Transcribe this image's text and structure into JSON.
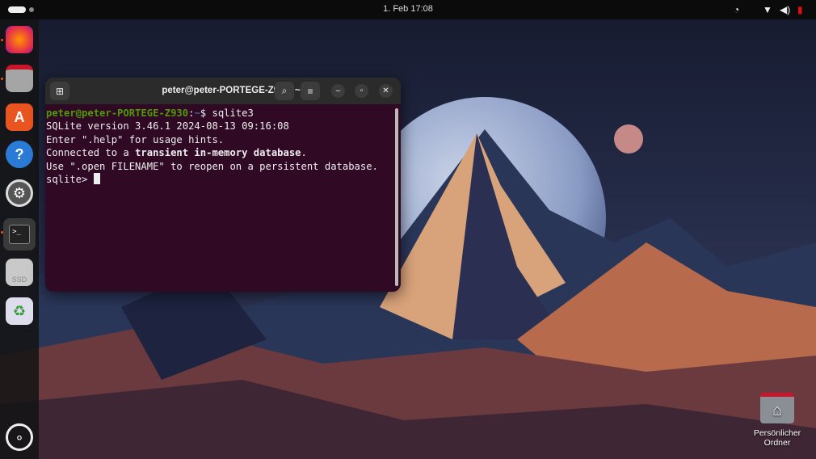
{
  "topbar": {
    "clock": "1. Feb  17:08",
    "tray_icons": [
      "power-profile-icon",
      "wifi-icon",
      "volume-icon",
      "battery-low-icon"
    ]
  },
  "dock": {
    "items": [
      {
        "name": "firefox"
      },
      {
        "name": "files"
      },
      {
        "name": "app-center"
      },
      {
        "name": "help",
        "glyph": "?"
      },
      {
        "name": "settings"
      },
      {
        "name": "terminal",
        "glyph": ">_"
      },
      {
        "name": "ssd",
        "glyph": "SSD"
      },
      {
        "name": "trash"
      },
      {
        "name": "show-apps"
      }
    ]
  },
  "terminal": {
    "title": "peter@peter-PORTEGE-Z930: ~",
    "prompt_user": "peter@peter-PORTEGE-Z930",
    "prompt_sep": ":",
    "prompt_path": "~",
    "prompt_end": "$ ",
    "command": "sqlite3",
    "line1": "SQLite version 3.46.1 2024-08-13 09:16:08",
    "line2": "Enter \".help\" for usage hints.",
    "line3_a": "Connected to a ",
    "line3_b": "transient in-memory database",
    "line3_c": ".",
    "line4": "Use \".open FILENAME\" to reopen on a persistent database.",
    "line5": "sqlite> "
  },
  "desktop": {
    "home_label": "Persönlicher Ordner"
  },
  "colors": {
    "terminal_bg": "#300a24",
    "accent": "#e95420",
    "prompt_green": "#4e9a06"
  }
}
